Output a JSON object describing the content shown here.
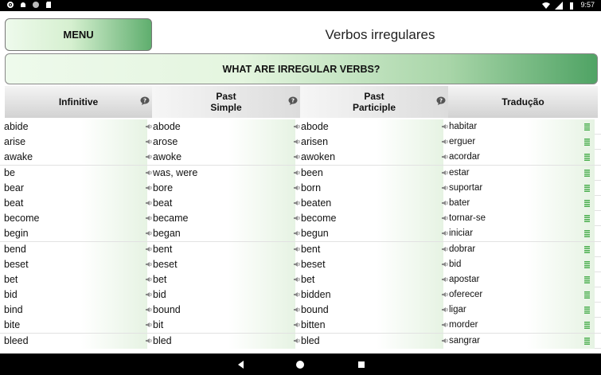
{
  "status_bar": {
    "time": "9:57",
    "left_icons": [
      "gear-icon",
      "android-icon",
      "circle-icon",
      "sd-card-icon"
    ],
    "right_icons": [
      "wifi-icon",
      "signal-icon",
      "battery-icon"
    ]
  },
  "header": {
    "menu_label": "MENU",
    "title": "Verbos irregulares"
  },
  "banner": {
    "label": "WHAT ARE IRREGULAR VERBS?"
  },
  "table": {
    "columns": [
      {
        "label": "Infinitive"
      },
      {
        "label": "Past\nSimple"
      },
      {
        "label": "Past\nParticiple"
      },
      {
        "label": "Tradução"
      }
    ],
    "rows": [
      {
        "infinitive": "abide",
        "past_simple": "abode",
        "past_participle": "abode",
        "translation": "habitar"
      },
      {
        "infinitive": "arise",
        "past_simple": "arose",
        "past_participle": "arisen",
        "translation": "erguer"
      },
      {
        "infinitive": "awake",
        "past_simple": "awoke",
        "past_participle": "awoken",
        "translation": "acordar"
      },
      {
        "infinitive": "be",
        "past_simple": "was, were",
        "past_participle": "been",
        "translation": "estar"
      },
      {
        "infinitive": "bear",
        "past_simple": "bore",
        "past_participle": "born",
        "translation": "suportar"
      },
      {
        "infinitive": "beat",
        "past_simple": "beat",
        "past_participle": "beaten",
        "translation": "bater"
      },
      {
        "infinitive": "become",
        "past_simple": "became",
        "past_participle": "become",
        "translation": "tornar-se"
      },
      {
        "infinitive": "begin",
        "past_simple": "began",
        "past_participle": "begun",
        "translation": "iniciar"
      },
      {
        "infinitive": "bend",
        "past_simple": "bent",
        "past_participle": "bent",
        "translation": "dobrar"
      },
      {
        "infinitive": "beset",
        "past_simple": "beset",
        "past_participle": "beset",
        "translation": "bid"
      },
      {
        "infinitive": "bet",
        "past_simple": "bet",
        "past_participle": "bet",
        "translation": "apostar"
      },
      {
        "infinitive": "bid",
        "past_simple": "bid",
        "past_participle": "bidden",
        "translation": "oferecer"
      },
      {
        "infinitive": "bind",
        "past_simple": "bound",
        "past_participle": "bound",
        "translation": "ligar"
      },
      {
        "infinitive": "bite",
        "past_simple": "bit",
        "past_participle": "bitten",
        "translation": "morder"
      },
      {
        "infinitive": "bleed",
        "past_simple": "bled",
        "past_participle": "bled",
        "translation": "sangrar"
      }
    ]
  },
  "nav_bar": {
    "icons": [
      "back-icon",
      "home-icon",
      "recents-icon"
    ]
  },
  "colors": {
    "accent_green": "#4fa364",
    "light_green": "#eefaec",
    "list_icon_green": "#4caf50"
  }
}
